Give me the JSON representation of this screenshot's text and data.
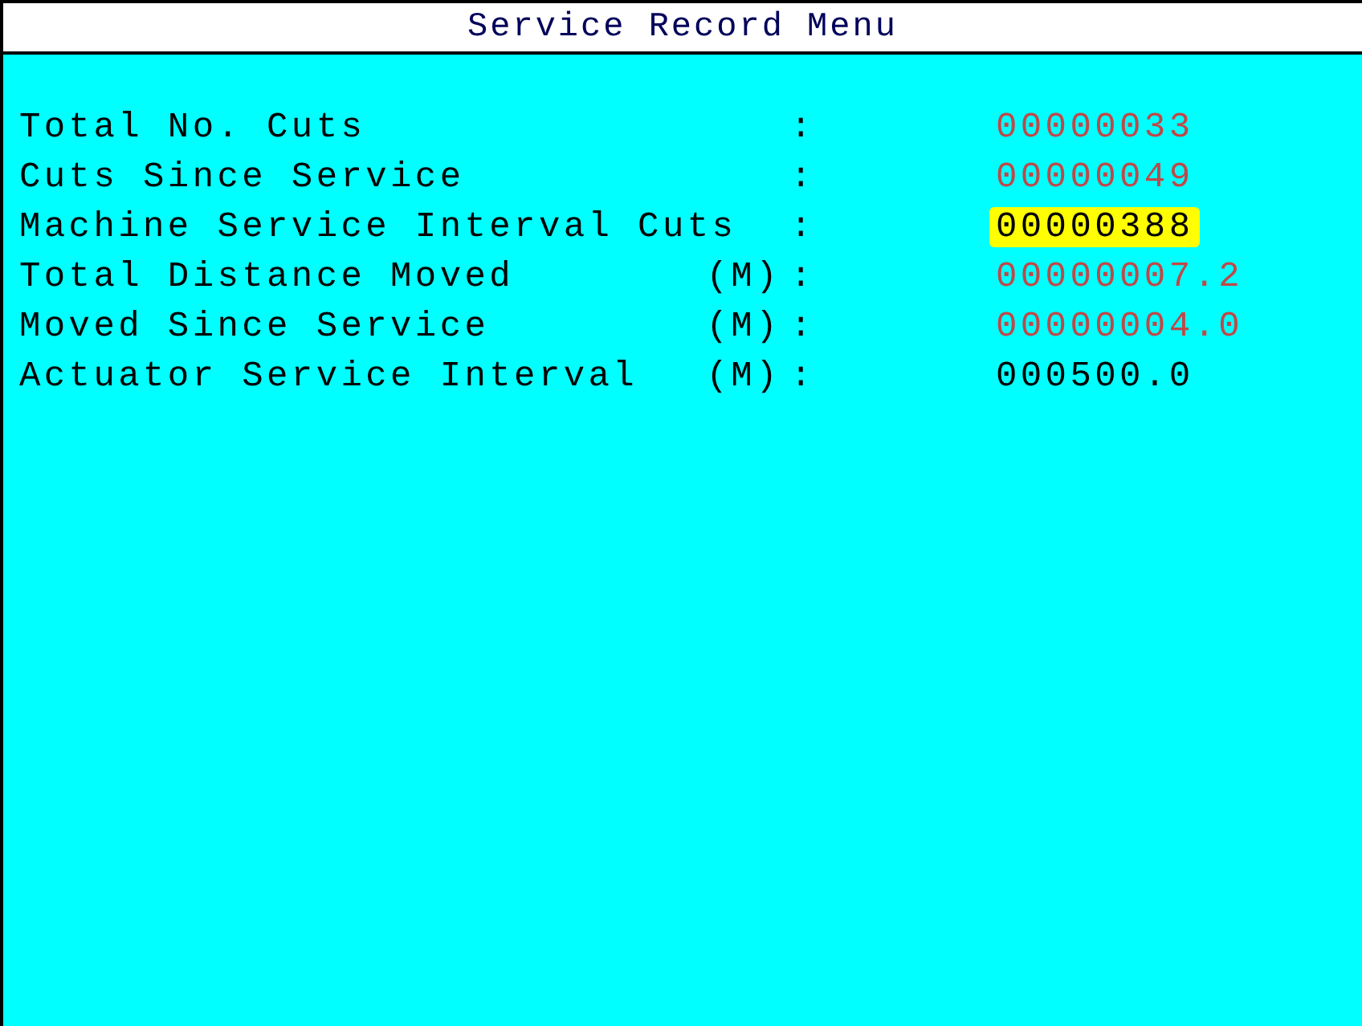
{
  "window": {
    "title": "Service Record Menu"
  },
  "rows": [
    {
      "label": "Total No. Cuts",
      "unit": "",
      "separator": ":",
      "value": "00000033",
      "kind": "readonly",
      "selected": false
    },
    {
      "label": "Cuts Since Service",
      "unit": "",
      "separator": ":",
      "value": "00000049",
      "kind": "readonly",
      "selected": false
    },
    {
      "label": "Machine Service Interval Cuts",
      "unit": "",
      "separator": ":",
      "value": "00000388",
      "kind": "editable",
      "selected": true
    },
    {
      "label": "Total Distance Moved",
      "unit": "(M)",
      "separator": ":",
      "value": "00000007.2",
      "kind": "readonly",
      "selected": false
    },
    {
      "label": "Moved Since Service",
      "unit": "(M)",
      "separator": ":",
      "value": "00000004.0",
      "kind": "readonly",
      "selected": false
    },
    {
      "label": "Actuator Service Interval",
      "unit": "(M)",
      "separator": ":",
      "value": "000500.0",
      "kind": "editable",
      "selected": false
    }
  ]
}
